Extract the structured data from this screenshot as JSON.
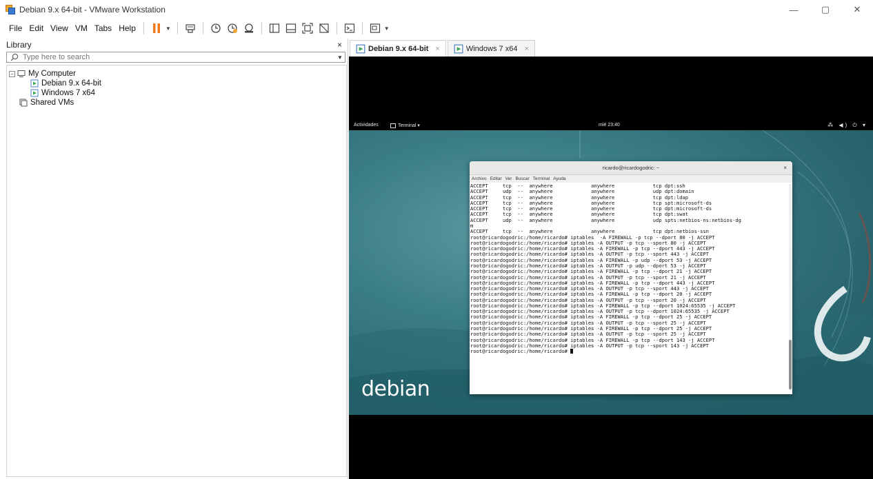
{
  "window": {
    "title": "Debian 9.x 64-bit - VMware Workstation",
    "controls": {
      "minimize": "—",
      "maximize": "▢",
      "close": "✕"
    }
  },
  "menu": {
    "items": [
      "File",
      "Edit",
      "View",
      "VM",
      "Tabs",
      "Help"
    ]
  },
  "library": {
    "title": "Library",
    "close": "×",
    "search_placeholder": "Type here to search",
    "tree": {
      "root": "My Computer",
      "vms": [
        "Debian 9.x 64-bit",
        "Windows 7 x64"
      ],
      "shared": "Shared VMs"
    }
  },
  "tabs": [
    {
      "label": "Debian 9.x 64-bit",
      "active": true
    },
    {
      "label": "Windows 7 x64",
      "active": false
    }
  ],
  "guest": {
    "topbar": {
      "activities": "Actividades",
      "app": "Terminal ▾",
      "clock": "mié 23:40",
      "tray": "⁂ ◀) ⏻ ▾"
    },
    "logo": "debian",
    "terminal": {
      "title": "ricardo@ricardogodric: ~",
      "close": "×",
      "menu": [
        "Archivo",
        "Editar",
        "Ver",
        "Buscar",
        "Terminal",
        "Ayuda"
      ],
      "lines": [
        "ACCEPT     tcp  --  anywhere             anywhere             tcp dpt:ssh",
        "ACCEPT     udp  --  anywhere             anywhere             udp dpt:domain",
        "ACCEPT     tcp  --  anywhere             anywhere             tcp dpt:ldap",
        "ACCEPT     tcp  --  anywhere             anywhere             tcp spt:microsoft-ds",
        "ACCEPT     tcp  --  anywhere             anywhere             tcp dpt:microsoft-ds",
        "ACCEPT     tcp  --  anywhere             anywhere             tcp dpt:swat",
        "ACCEPT     udp  --  anywhere             anywhere             udp spts:netbios-ns:netbios-dg",
        "m",
        "ACCEPT     tcp  --  anywhere             anywhere             tcp dpt:netbios-ssn",
        "root@ricardogodric:/home/ricardo# iptables  -A FIREWALL -p tcp --dport 80 -j ACCEPT",
        "root@ricardogodric:/home/ricardo# iptables -A OUTPUT -p tcp --sport 80 -j ACCEPT",
        "root@ricardogodric:/home/ricardo# iptables -A FIREWALL -p tcp --dport 443 -j ACCEPT",
        "root@ricardogodric:/home/ricardo# iptables -A OUTPUT -p tcp --sport 443 -j ACCEPT",
        "root@ricardogodric:/home/ricardo# iptables -A FIREWALL -p udp --dport 53 -j ACCEPT",
        "root@ricardogodric:/home/ricardo# iptables -A OUTPUT -p udp --dport 53 -j ACCEPT",
        "root@ricardogodric:/home/ricardo# iptables -A FIREWALL -p tcp --dport 21 -j ACCEPT",
        "root@ricardogodric:/home/ricardo# iptables -A OUTPUT -p tcp --sport 21 -j ACCEPT",
        "root@ricardogodric:/home/ricardo# iptables -A FIREWALL -p tcp --dport 443 -j ACCEPT",
        "root@ricardogodric:/home/ricardo# iptables -A OUTPUT -p tcp --sport 443 -j ACCEPT",
        "root@ricardogodric:/home/ricardo# iptables -A FIREWALL -p tcp --dport 20 -j ACCEPT",
        "root@ricardogodric:/home/ricardo# iptables -A OUTPUT -p tcp --sport 20 -j ACCEPT",
        "root@ricardogodric:/home/ricardo# iptables -A FIREWALL -p tcp --dport 1024:65535 -j ACCEPT",
        "root@ricardogodric:/home/ricardo# iptables -A OUTPUT -p tcp --dport 1024:65535 -j ACCEPT",
        "root@ricardogodric:/home/ricardo# iptables -A FIREWALL -p tcp --dport 25 -j ACCEPT",
        "root@ricardogodric:/home/ricardo# iptables -A OUTPUT -p tcp --sport 25 -j ACCEPT",
        "root@ricardogodric:/home/ricardo# iptables -A FIREWALL -p tcp --dport 25 -j ACCEPT",
        "root@ricardogodric:/home/ricardo# iptables -A OUTPUT -p tcp --sport 25 -j ACCEPT",
        "root@ricardogodric:/home/ricardo# iptables -A FIREWALL -p tcp --dport 143 -j ACCEPT",
        "root@ricardogodric:/home/ricardo# iptables -A OUTPUT -p tcp --sport 143 -j ACCEPT"
      ],
      "prompt": "root@ricardogodric:/home/ricardo# "
    }
  },
  "colors": {
    "pause_accent": "#f07a1a",
    "vm_icon_green": "#3aa655",
    "desktop_teal": "#3b7d86"
  },
  "icons": {
    "toolbar": [
      "pause-icon",
      "send-keys-icon",
      "snapshot-icon",
      "revert-snapshot-icon",
      "snapshot-manager-icon",
      "show-library-icon",
      "thumbnail-bar-icon",
      "full-screen-icon",
      "unity-icon",
      "console-view-icon",
      "stretch-guest-icon"
    ]
  }
}
